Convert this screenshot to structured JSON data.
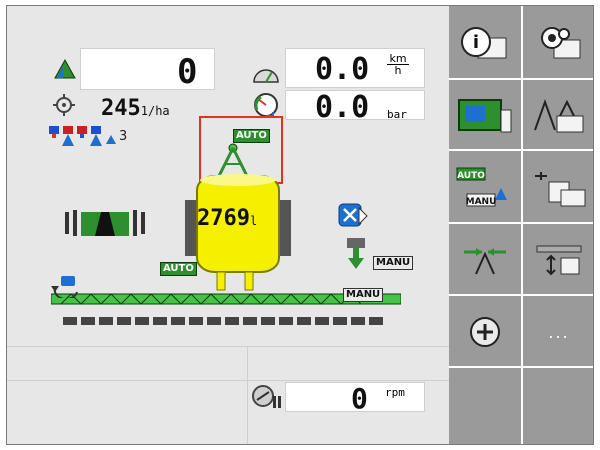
{
  "main": {
    "area_value": "0",
    "rate_value": "245",
    "rate_unit": "1/ha",
    "sections_count": "3",
    "speed_value": "0.0",
    "speed_unit_top": "km",
    "speed_unit_bottom": "h",
    "pressure_value": "0.0",
    "pressure_unit": "bar",
    "boom_mode": "AUTO",
    "tank_value": "2769",
    "tank_unit": "l",
    "tank_mode": "AUTO",
    "nozzle_mode": "MANU",
    "boom_manu": "MANU",
    "rpm_value": "0",
    "rpm_unit": "rpm"
  },
  "side": {
    "info_label": "i",
    "auto_label": "AUTO",
    "manu_label": "MANU",
    "more_label": "..."
  },
  "colors": {
    "frame_bg": "#e9e9e9",
    "side_bg": "#9a9a9a",
    "green": "#2d8f2d",
    "tank_yellow": "#f4f000",
    "highlight": "#e0341f",
    "blue": "#1d6fd2"
  }
}
